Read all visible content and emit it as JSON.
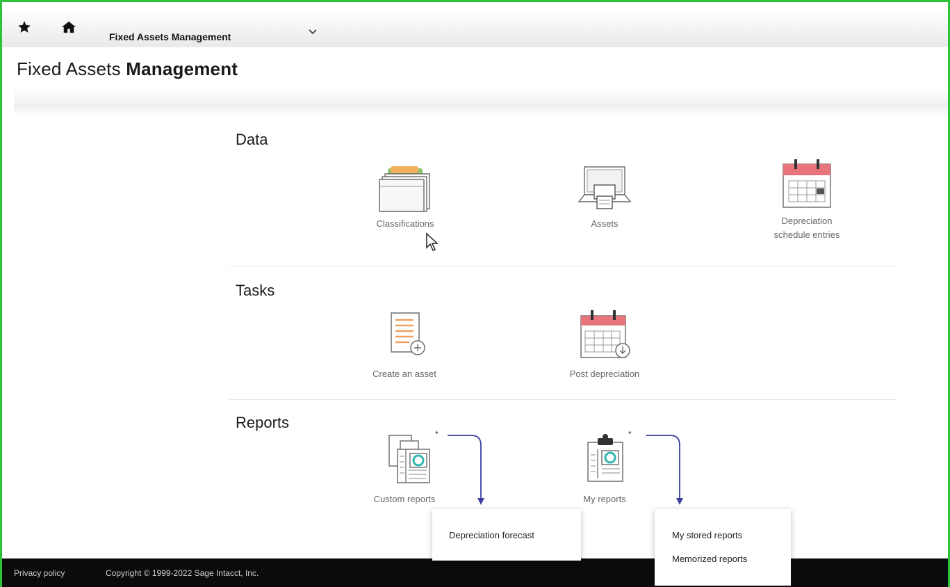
{
  "nav": {
    "breadcrumb": "Fixed Assets Management",
    "star_icon": "star-icon",
    "home_icon": "home-icon",
    "chevron_icon": "chevron-down-icon"
  },
  "page": {
    "title_prefix": "Fixed Assets ",
    "title_bold": "Management"
  },
  "sections": {
    "data": {
      "title": "Data",
      "items": [
        {
          "label": "Classifications",
          "icon": "folders-icon"
        },
        {
          "label": "Assets",
          "icon": "computer-printer-icon"
        },
        {
          "label": "Depreciation schedule entries",
          "label_line1": "Depreciation",
          "label_line2": "schedule entries",
          "icon": "calendar-icon"
        }
      ]
    },
    "tasks": {
      "title": "Tasks",
      "items": [
        {
          "label": "Create an asset",
          "icon": "document-add-icon"
        },
        {
          "label": "Post depreciation",
          "icon": "calendar-download-icon"
        }
      ]
    },
    "reports": {
      "title": "Reports",
      "items": [
        {
          "label": "Custom reports",
          "icon": "custom-reports-icon",
          "asterisk": "*"
        },
        {
          "label": "My reports",
          "icon": "clipboard-report-icon",
          "asterisk": "*"
        }
      ]
    }
  },
  "popups": {
    "custom": [
      "Depreciation forecast"
    ],
    "my": [
      "My stored reports",
      "Memorized reports"
    ]
  },
  "footer": {
    "privacy": "Privacy policy",
    "copyright": "Copyright © 1999-2022 Sage Intacct, Inc."
  },
  "colors": {
    "frame": "#2ec23a",
    "calendar_red": "#e8747c",
    "report_teal": "#2fb7b1",
    "accent_orange": "#f0a060",
    "arrow_navy": "#3a3f9e"
  }
}
